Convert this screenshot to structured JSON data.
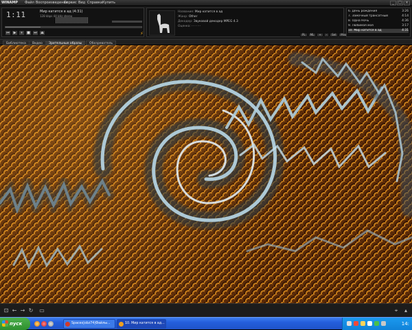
{
  "titlebar": {
    "logo": "WINAMP",
    "menu": [
      "Файл",
      "Воспроизведение",
      "Сервис",
      "Вид",
      "Справка",
      "Купить"
    ]
  },
  "player": {
    "time": "1:11",
    "song_title": "Мир катится в ад (4:31)",
    "bitrate": "128 kbps   44 kHz   stereo",
    "seek_progress": 0.26,
    "controls": [
      "⏮",
      "▶",
      "⏸",
      "■",
      "⏭",
      "⏏"
    ]
  },
  "info": {
    "rows": [
      {
        "key": "Название:",
        "value": "Мир катится в ад"
      },
      {
        "key": "Жанр:",
        "value": "Other"
      },
      {
        "key": "Декодер:",
        "value": "Звуковой декодер MPEG 4.3"
      },
      {
        "key": "Оценка:",
        "value": "· · · · ·"
      }
    ],
    "buttons": [
      "PL",
      "ML",
      "+",
      "-",
      "Sel",
      "Misc"
    ]
  },
  "playlist": [
    {
      "n": "6. День рождения",
      "d": "3:26"
    },
    {
      "n": "7. Замочный трансатный",
      "d": "4:14"
    },
    {
      "n": "8. Одна Ночь",
      "d": "4:36"
    },
    {
      "n": "9. Любимая моя",
      "d": "3:17"
    },
    {
      "n": "10. Мир катится в ад",
      "d": "4:31",
      "selected": true
    }
  ],
  "tabs": [
    "Библиотека",
    "Видео",
    "Зрительные образы",
    "Обозреватель"
  ],
  "active_tab": 2,
  "taskbar": {
    "start": "пуск",
    "tasks": [
      {
        "label": "Spaces|obz74|Файлы...",
        "icon_color": "#d23a2a"
      },
      {
        "label": "10. Мир катится в ад...",
        "icon_color": "#f0a020"
      }
    ],
    "clock": "14:"
  }
}
